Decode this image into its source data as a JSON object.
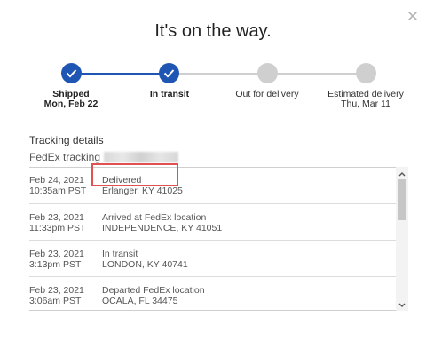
{
  "modal": {
    "title": "It's on the way."
  },
  "progress": {
    "steps": [
      {
        "label": "Shipped",
        "sublabel": "Mon, Feb 22",
        "state": "done"
      },
      {
        "label": "In transit",
        "sublabel": "",
        "state": "done"
      },
      {
        "label": "Out for delivery",
        "sublabel": "",
        "state": "todo"
      },
      {
        "label": "Estimated delivery",
        "sublabel": "Thu, Mar 11",
        "state": "todo"
      }
    ]
  },
  "tracking": {
    "title": "Tracking details",
    "carrier_label": "FedEx tracking",
    "events": [
      {
        "date": "Feb 24, 2021",
        "time": "10:35am PST",
        "status": "Delivered",
        "location": "Erlanger, KY 41025"
      },
      {
        "date": "Feb 23, 2021",
        "time": "11:33pm PST",
        "status": "Arrived at FedEx location",
        "location": "INDEPENDENCE, KY 41051"
      },
      {
        "date": "Feb 23, 2021",
        "time": "3:13pm PST",
        "status": "In transit",
        "location": "LONDON, KY 40741"
      },
      {
        "date": "Feb 23, 2021",
        "time": "3:06am PST",
        "status": "Departed FedEx location",
        "location": "OCALA, FL 34475"
      }
    ]
  },
  "icons": {
    "close": "close-icon",
    "check": "check-icon",
    "scroll_up": "chevron-up-icon",
    "scroll_down": "chevron-down-icon"
  },
  "colors": {
    "accent": "#1f55b3",
    "inactive": "#cfcfcf",
    "highlight": "#e05252"
  }
}
